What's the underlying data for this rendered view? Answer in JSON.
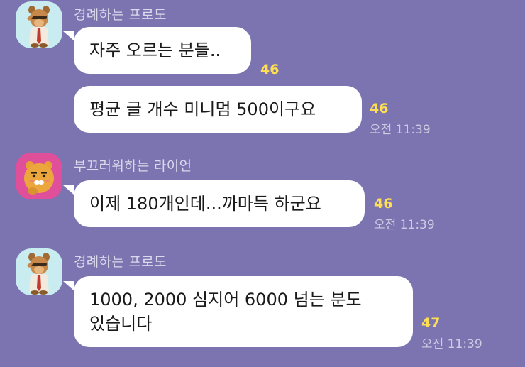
{
  "messages": [
    {
      "sender": "경례하는 프로도",
      "avatar_icon": "frodo-saluting-avatar-icon",
      "bubbles": [
        {
          "text": "자주 오르는 분들..",
          "unread": "46",
          "time": ""
        },
        {
          "text": "평균 글 개수 미니멈 500이구요",
          "unread": "46",
          "time": "오전 11:39"
        }
      ]
    },
    {
      "sender": "부끄러워하는 라이언",
      "avatar_icon": "ryan-shy-avatar-icon",
      "bubbles": [
        {
          "text": "이제 180개인데...까마득 하군요",
          "unread": "46",
          "time": "오전 11:39"
        }
      ]
    },
    {
      "sender": "경례하는 프로도",
      "avatar_icon": "frodo-saluting-avatar-icon",
      "bubbles": [
        {
          "line1": "1000, 2000 심지어 6000 넘는 분도",
          "line2": "있습니다",
          "unread": "47",
          "time": "오전 11:39"
        }
      ]
    }
  ],
  "colors": {
    "background": "#7b74b0",
    "bubble": "#ffffff",
    "unread": "#fdde54",
    "frodo_avatar_bg": "#c9ecf1",
    "ryan_avatar_bg": "#e0509a"
  }
}
